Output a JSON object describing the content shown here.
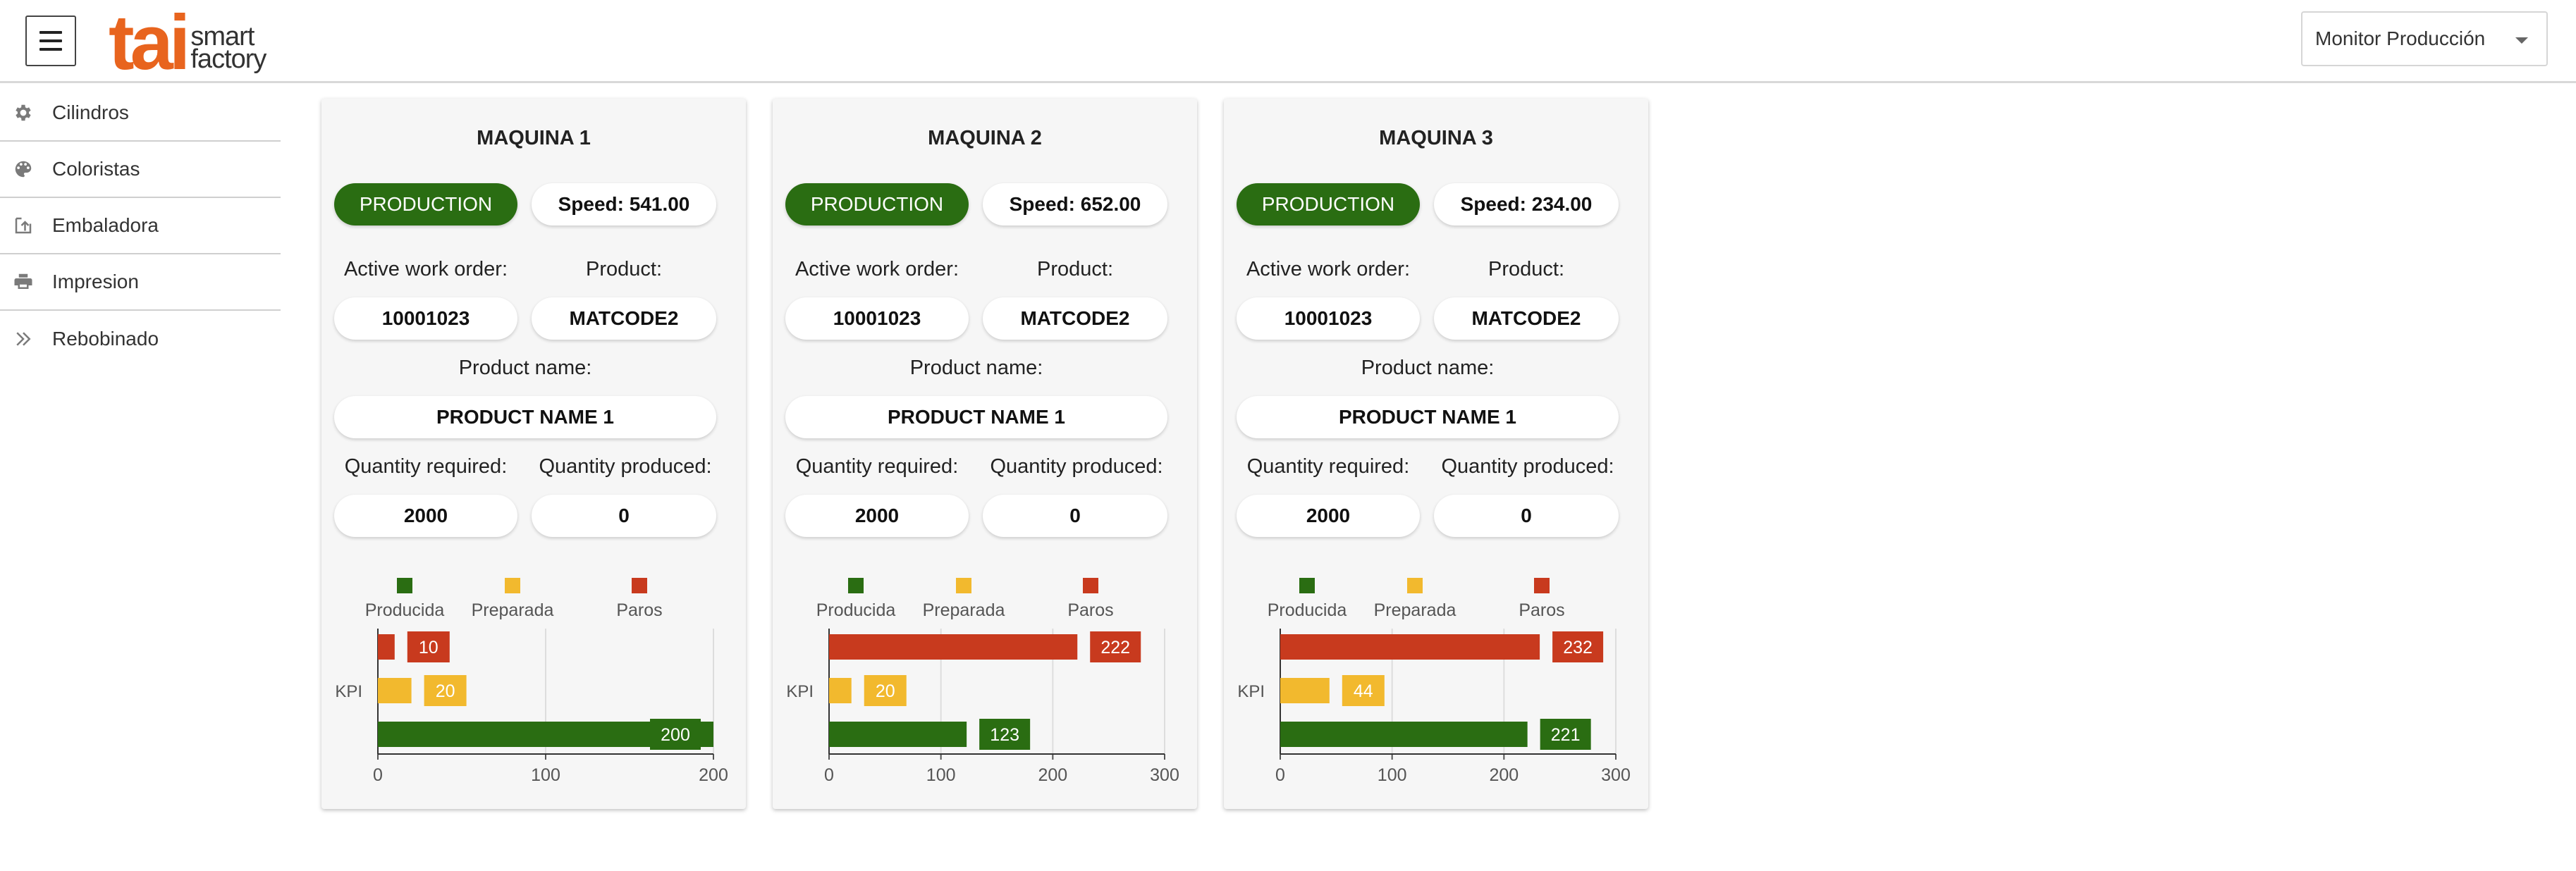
{
  "header": {
    "logo_main": "tai",
    "logo_line1": "smart",
    "logo_line2": "factory",
    "selector_value": "Monitor Producción"
  },
  "sidebar": {
    "items": [
      {
        "label": "Cilindros",
        "icon": "gear-icon"
      },
      {
        "label": "Coloristas",
        "icon": "palette-icon"
      },
      {
        "label": "Embaladora",
        "icon": "box-upload-icon"
      },
      {
        "label": "Impresion",
        "icon": "printer-icon"
      },
      {
        "label": "Rebobinado",
        "icon": "double-chevron-right-icon"
      }
    ]
  },
  "labels": {
    "active_work_order": "Active work order:",
    "product": "Product:",
    "product_name": "Product name:",
    "quantity_required": "Quantity required:",
    "quantity_produced": "Quantity produced:"
  },
  "colors": {
    "producida": "#2a6d12",
    "preparada": "#f2b92e",
    "paros": "#c83a1e",
    "status_production": "#2a6d12",
    "brand": "#e8641e"
  },
  "legend": [
    "Producida",
    "Preparada",
    "Paros"
  ],
  "machines": [
    {
      "title": "MAQUINA 1",
      "status": "PRODUCTION",
      "speed": "Speed: 541.00",
      "work_order": "10001023",
      "product": "MATCODE2",
      "product_name": "PRODUCT NAME 1",
      "qty_required": "2000",
      "qty_produced": "0"
    },
    {
      "title": "MAQUINA 2",
      "status": "PRODUCTION",
      "speed": "Speed: 652.00",
      "work_order": "10001023",
      "product": "MATCODE2",
      "product_name": "PRODUCT NAME 1",
      "qty_required": "2000",
      "qty_produced": "0"
    },
    {
      "title": "MAQUINA 3",
      "status": "PRODUCTION",
      "speed": "Speed: 234.00",
      "work_order": "10001023",
      "product": "MATCODE2",
      "product_name": "PRODUCT NAME 1",
      "qty_required": "2000",
      "qty_produced": "0"
    }
  ],
  "chart_data": [
    {
      "type": "bar",
      "orientation": "horizontal",
      "categories": [
        "KPI"
      ],
      "series": [
        {
          "name": "Paros",
          "values": [
            10
          ]
        },
        {
          "name": "Preparada",
          "values": [
            20
          ]
        },
        {
          "name": "Producida",
          "values": [
            200
          ]
        }
      ],
      "xlim": [
        0,
        200
      ],
      "xticks": [
        "0",
        "100",
        "200"
      ],
      "legend": "top"
    },
    {
      "type": "bar",
      "orientation": "horizontal",
      "categories": [
        "KPI"
      ],
      "series": [
        {
          "name": "Paros",
          "values": [
            222
          ]
        },
        {
          "name": "Preparada",
          "values": [
            20
          ]
        },
        {
          "name": "Producida",
          "values": [
            123
          ]
        }
      ],
      "xlim": [
        0,
        300
      ],
      "xticks": [
        "0",
        "100",
        "200",
        "300"
      ],
      "legend": "top"
    },
    {
      "type": "bar",
      "orientation": "horizontal",
      "categories": [
        "KPI"
      ],
      "series": [
        {
          "name": "Paros",
          "values": [
            232
          ]
        },
        {
          "name": "Preparada",
          "values": [
            44
          ]
        },
        {
          "name": "Producida",
          "values": [
            221
          ]
        }
      ],
      "xlim": [
        0,
        300
      ],
      "xticks": [
        "0",
        "100",
        "200",
        "300"
      ],
      "legend": "top"
    }
  ]
}
